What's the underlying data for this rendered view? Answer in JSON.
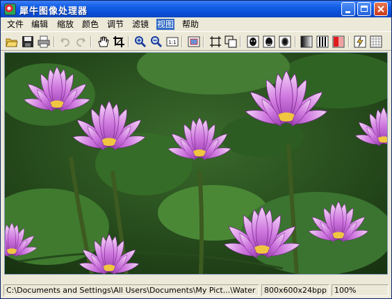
{
  "window": {
    "title": "犀牛图像处理器",
    "icon": "app-icon",
    "controls": [
      "minimize-icon",
      "maximize-icon",
      "close-icon"
    ]
  },
  "menu": [
    "文件",
    "编辑",
    "缩放",
    "颜色",
    "调节",
    "滤镜",
    "视图",
    "帮助"
  ],
  "active_menu": "视图",
  "toolbar": [
    "open-folder-icon",
    "save-icon",
    "print-icon",
    "undo-icon",
    "redo-icon",
    "hand-pan-icon",
    "crop-icon",
    "zoom-in-icon",
    "zoom-out-icon",
    "actual-size-icon",
    "fit-window-icon",
    "select-icon",
    "resize-icon",
    "effect-mask-1-icon",
    "effect-mask-2-icon",
    "effect-mask-3-icon",
    "grayscale-icon",
    "channels-icon",
    "color-balance-icon",
    "sharpen-icon",
    "grid-icon"
  ],
  "image": {
    "subject": "pink water lilies",
    "colors": {
      "leaf": "#2f5a24",
      "petal": "#c56bd6",
      "center": "#f0c640"
    }
  },
  "status": {
    "path": "C:\\Documents and Settings\\All Users\\Documents\\My Pict...\\Water",
    "size": "800x600x24bpp",
    "zoom": "100%"
  }
}
